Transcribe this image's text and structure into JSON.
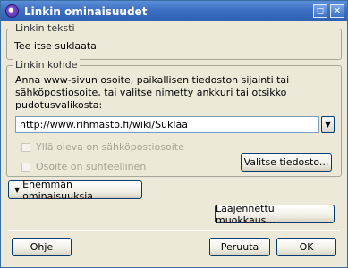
{
  "window": {
    "title": "Linkin ominaisuudet",
    "buttons": {
      "restore": "◻",
      "close": "✕"
    }
  },
  "link_text_group": {
    "legend": "Linkin teksti",
    "value": "Tee itse suklaata"
  },
  "link_target_group": {
    "legend": "Linkin kohde",
    "description": "Anna www-sivun osoite, paikallisen tiedoston sijainti tai sähköpostiosoite, tai valitse nimetty ankkuri tai otsikko pudotusvalikosta:",
    "url_value": "http://www.rihmasto.fi/wiki/Suklaa",
    "checkbox_email": "Yllä oleva on sähköpostiosoite",
    "checkbox_relative": "Osoite on suhteellinen",
    "browse_button": "Valitse tiedosto..."
  },
  "more_button": "Enemmän ominaisuuksia",
  "advanced_button": "Laajennettu muokkaus...",
  "footer": {
    "help_button": "Ohje",
    "cancel_button": "Peruuta",
    "ok_button": "OK"
  }
}
